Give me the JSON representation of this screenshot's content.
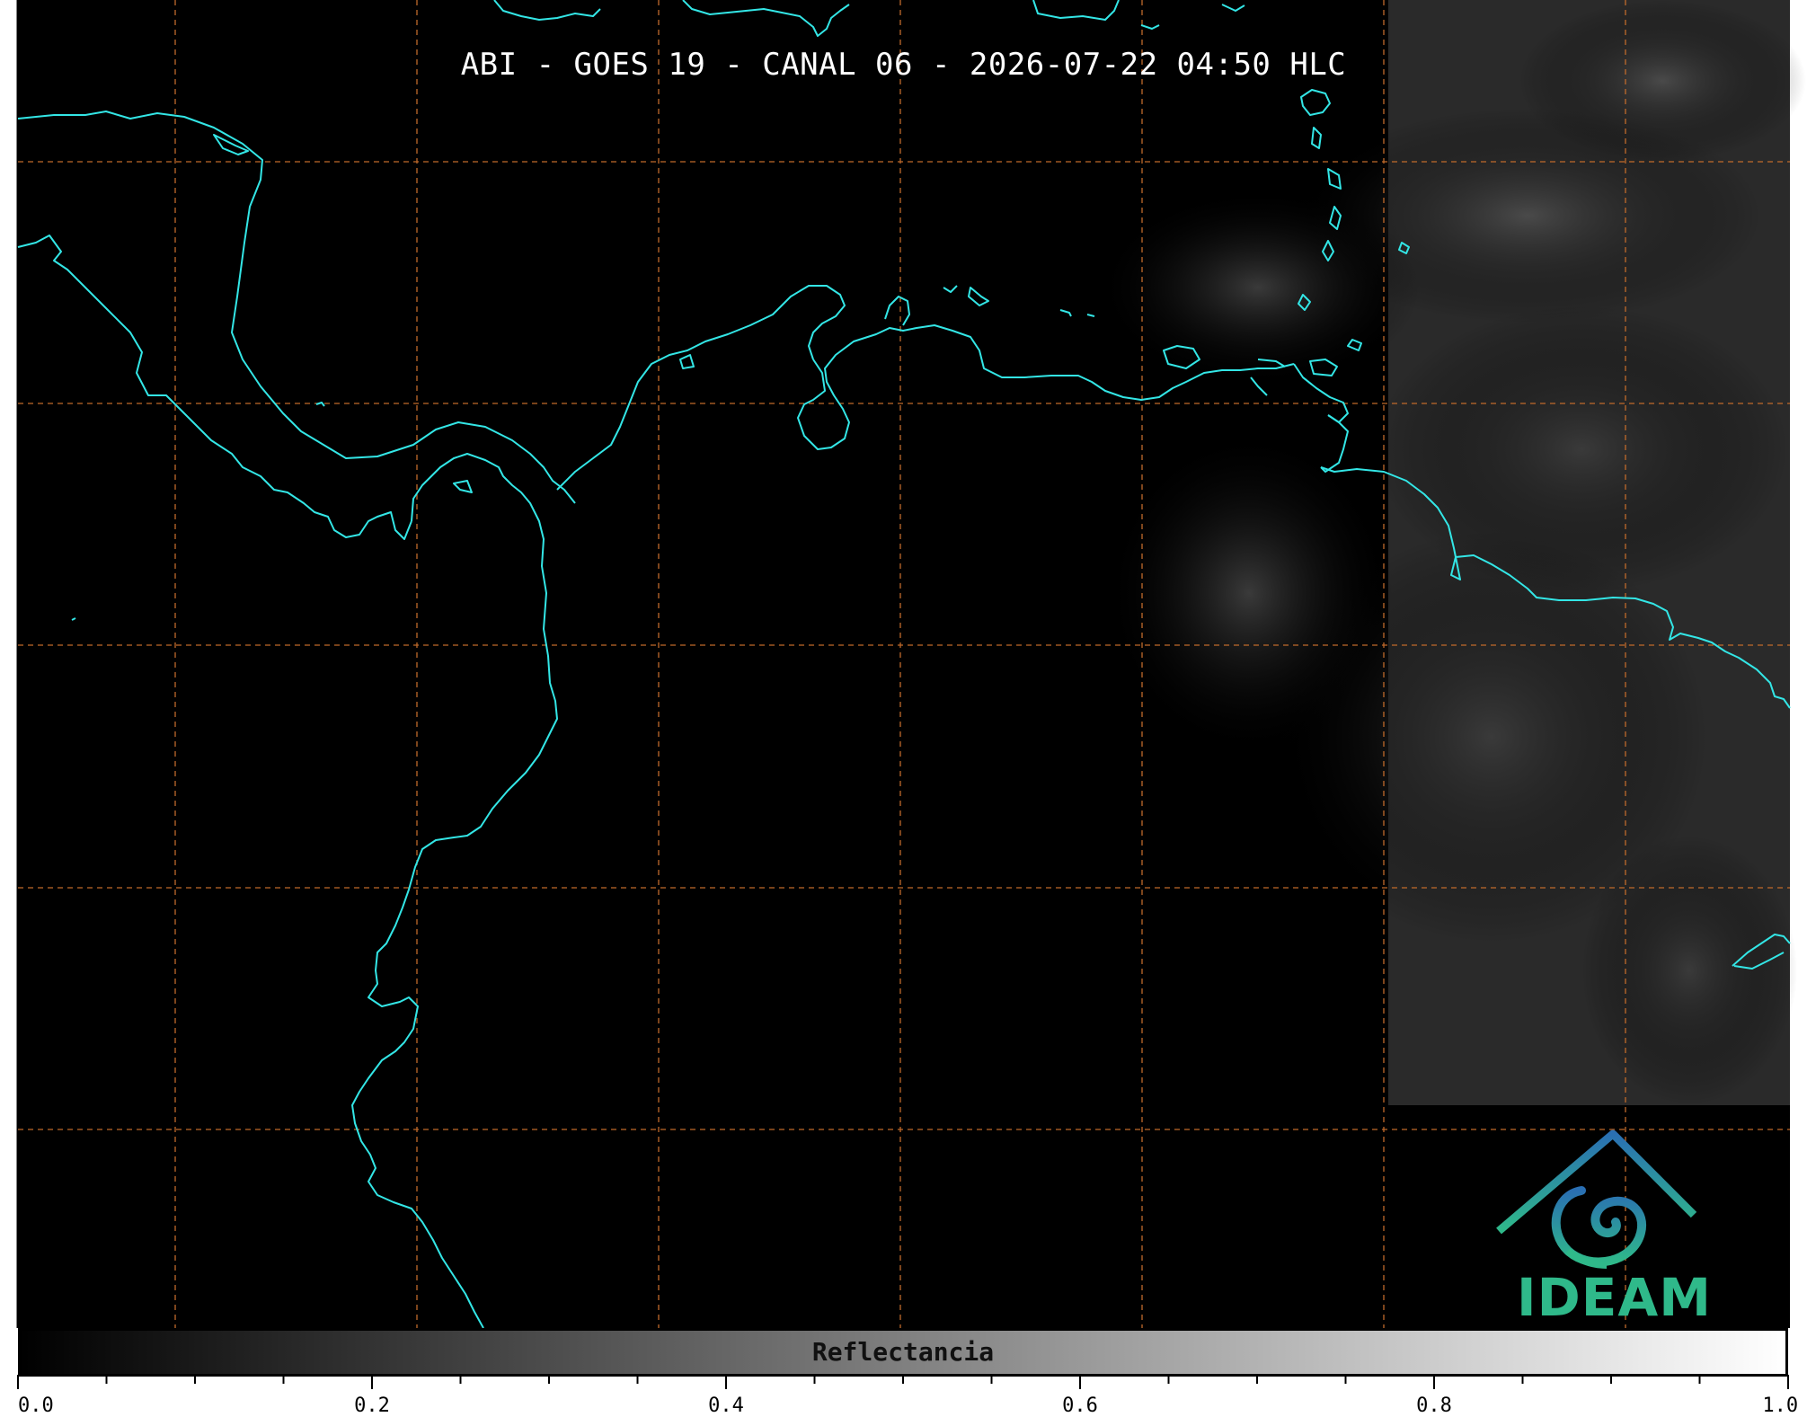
{
  "title": "ABI - GOES 19 - CANAL 06 - 2026-07-22 04:50 HLC",
  "colorbar": {
    "label": "Reflectancia",
    "range": [
      0.0,
      1.0
    ],
    "ticks": [
      "0.0",
      "0.2",
      "0.4",
      "0.6",
      "0.8",
      "1.0"
    ],
    "colormap": "grayscale",
    "start_color": "#000000",
    "end_color": "#ffffff"
  },
  "map": {
    "background": "#000000",
    "coastline_color": "#33e6e6",
    "gridline_color": "#c06a2b",
    "gridline_style": "dashed",
    "cloud_region": "east"
  },
  "logo": {
    "text": "IDEAM",
    "colors": [
      "#2a6fb3",
      "#2fb98a"
    ]
  }
}
